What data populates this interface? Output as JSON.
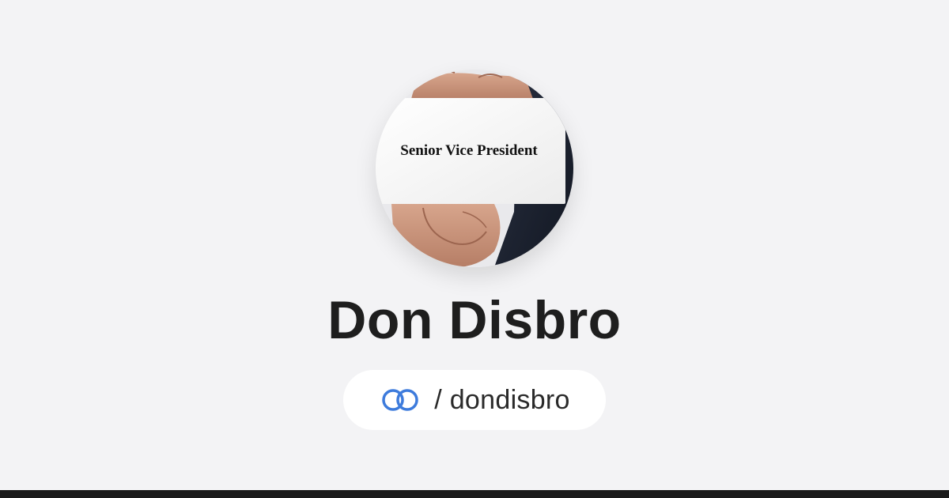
{
  "profile": {
    "avatar_card_text": "Senior Vice President",
    "name": "Don Disbro",
    "handle": "/ dondisbro",
    "link_icon": "linked-rings-icon"
  },
  "colors": {
    "background": "#f3f3f5",
    "name_text": "#1e1e1e",
    "pill_background": "#ffffff",
    "accent_blue": "#3d7bdc",
    "footer_bar": "#1a1a1a"
  }
}
